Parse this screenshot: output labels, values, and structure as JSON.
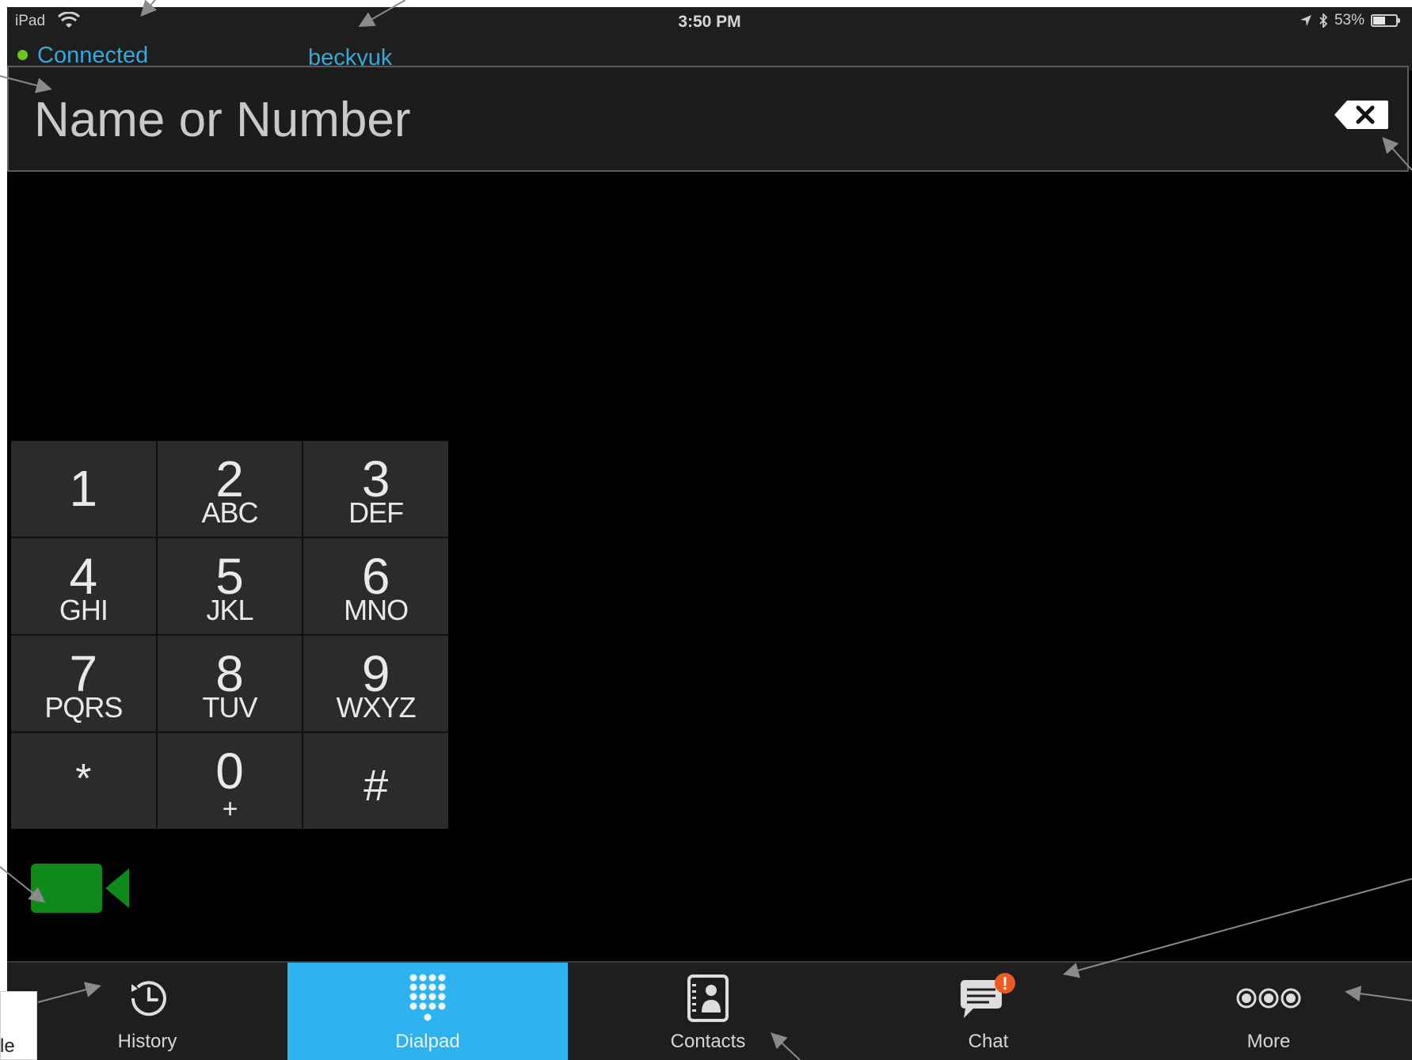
{
  "status_bar": {
    "carrier": "iPad",
    "time": "3:50 PM",
    "battery": "53%",
    "battery_level": 0.53
  },
  "connection": {
    "status": "Connected",
    "username": "beckyuk"
  },
  "search": {
    "placeholder": "Name or Number",
    "value": ""
  },
  "keypad": {
    "keys": [
      {
        "digit": "1",
        "letters": ""
      },
      {
        "digit": "2",
        "letters": "ABC"
      },
      {
        "digit": "3",
        "letters": "DEF"
      },
      {
        "digit": "4",
        "letters": "GHI"
      },
      {
        "digit": "5",
        "letters": "JKL"
      },
      {
        "digit": "6",
        "letters": "MNO"
      },
      {
        "digit": "7",
        "letters": "PQRS"
      },
      {
        "digit": "8",
        "letters": "TUV"
      },
      {
        "digit": "9",
        "letters": "WXYZ"
      },
      {
        "digit": "*",
        "letters": ""
      },
      {
        "digit": "0",
        "letters": "+"
      },
      {
        "digit": "#",
        "letters": ""
      }
    ]
  },
  "tabs": [
    {
      "label": "History",
      "icon": "clock-icon",
      "active": false
    },
    {
      "label": "Dialpad",
      "icon": "dialpad-icon",
      "active": true
    },
    {
      "label": "Contacts",
      "icon": "contacts-icon",
      "active": false
    },
    {
      "label": "Chat",
      "icon": "chat-icon",
      "active": false,
      "badge": "!"
    },
    {
      "label": "More",
      "icon": "more-icon",
      "active": false
    }
  ],
  "annotation": {
    "callout_text": "le"
  },
  "colors": {
    "accent": "#2fb2f0",
    "connected_dot": "#6ec41f",
    "link_text": "#35a8dc",
    "video_button": "#0d8a1a",
    "badge": "#f05a22"
  }
}
